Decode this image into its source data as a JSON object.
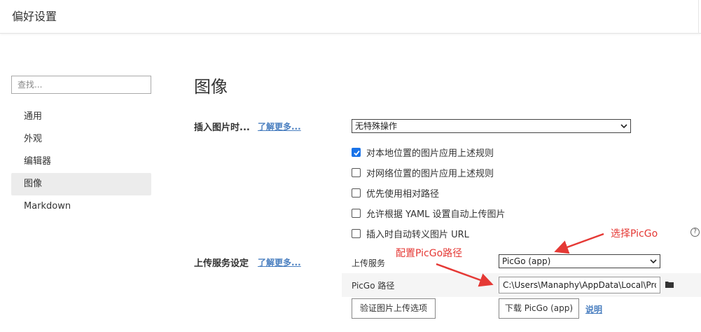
{
  "window": {
    "title": "偏好设置"
  },
  "search": {
    "placeholder": "查找..."
  },
  "sidebar": {
    "items": [
      {
        "label": "通用"
      },
      {
        "label": "外观"
      },
      {
        "label": "编辑器"
      },
      {
        "label": "图像",
        "active": true
      },
      {
        "label": "Markdown"
      }
    ]
  },
  "main": {
    "title": "图像",
    "insert_image": {
      "label": "插入图片时...",
      "learn_more": "了解更多...",
      "select_value": "无特殊操作",
      "options": [
        {
          "label": "对本地位置的图片应用上述规则",
          "checked": true
        },
        {
          "label": "对网络位置的图片应用上述规则",
          "checked": false
        },
        {
          "label": "优先使用相对路径",
          "checked": false
        },
        {
          "label": "允许根据 YAML 设置自动上传图片",
          "checked": false
        },
        {
          "label": "插入时自动转义图片 URL",
          "checked": false
        }
      ]
    },
    "upload": {
      "label": "上传服务设定",
      "learn_more": "了解更多...",
      "service_label": "上传服务",
      "service_value": "PicGo (app)",
      "path_label": "PicGo 路径",
      "path_value": "C:\\Users\\Manaphy\\AppData\\Local\\Programs\\PicGo\\PicGo.exe",
      "verify_button": "验证图片上传选项",
      "download_button": "下载 PicGo (app)",
      "explain_link": "说明"
    },
    "help_icon": "?"
  },
  "annotations": {
    "select_picgo": "选择PicGo",
    "config_path": "配置PicGo路径",
    "color": "#e53935"
  },
  "colors": {
    "accent": "#1a73e8",
    "link": "#4a7fc0",
    "active_nav_bg": "#ececec"
  }
}
